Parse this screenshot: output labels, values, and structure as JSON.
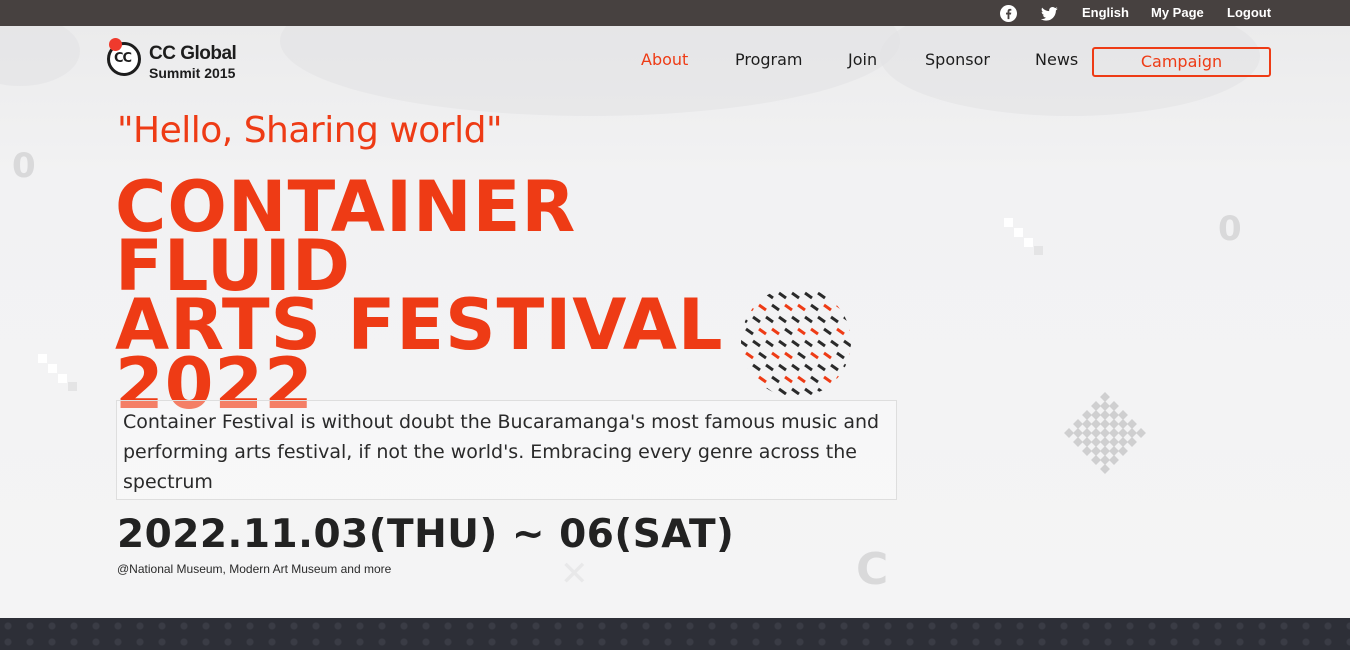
{
  "topbar": {
    "social": [
      "facebook-icon",
      "twitter-icon"
    ],
    "links": [
      "English",
      "My Page",
      "Logout"
    ]
  },
  "logo": {
    "mark": "CC",
    "line1": "CC Global",
    "line2": "Summit 2015"
  },
  "nav": {
    "items": [
      "About",
      "Program",
      "Join",
      "Sponsor",
      "News"
    ],
    "active": "About",
    "campaign_label": "Campaign"
  },
  "hero": {
    "tagline": "\"Hello, Sharing world\"",
    "headline_lines": [
      "CONTAINER FLUID",
      "ARTS FESTIVAL",
      "2022"
    ],
    "description": "Container Festival is without doubt the Bucaramanga's most famous music and performing arts festival, if not the world's. Embracing every genre across the spectrum",
    "date": "2022.11.03(THU) ~ 06(SAT)",
    "venue": "@National Museum, Modern Art Museum and more"
  },
  "colors": {
    "accent": "#ee3b15",
    "topbar": "#474140",
    "footer": "#2d2f37",
    "text_dark": "#222222"
  }
}
